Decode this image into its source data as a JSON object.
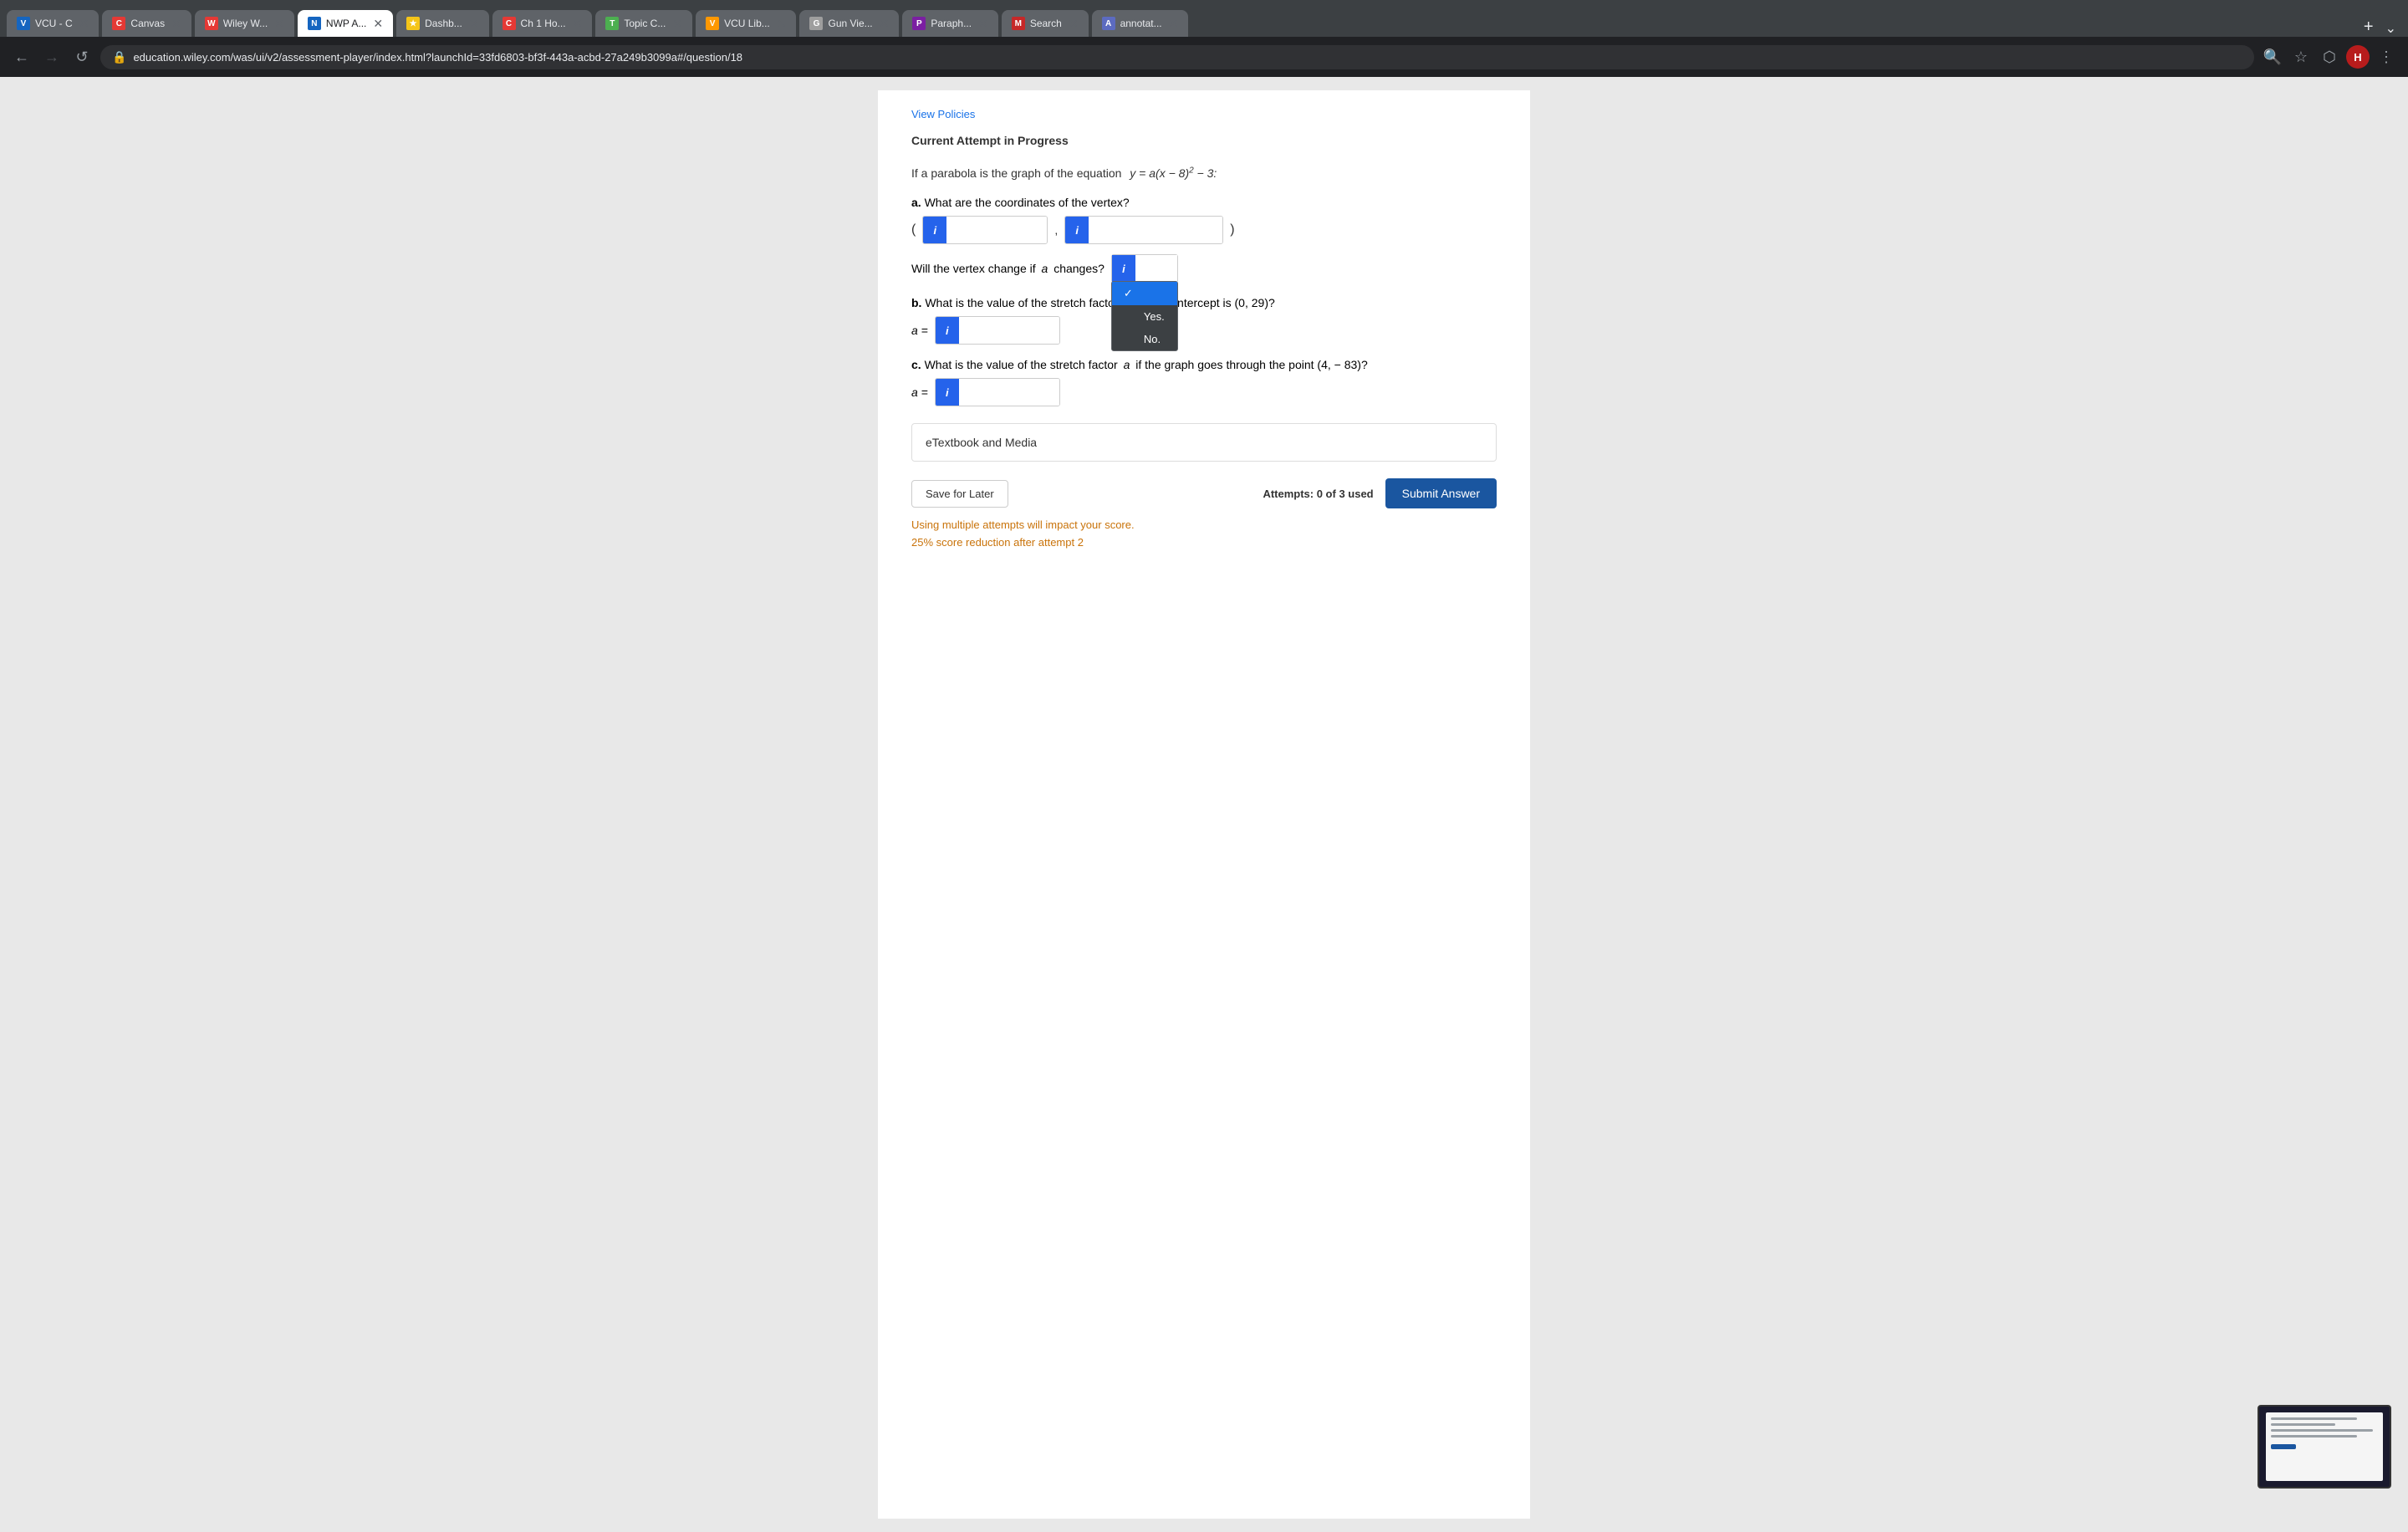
{
  "browser": {
    "url": "education.wiley.com/was/ui/v2/assessment-player/index.html?launchId=33fd6803-bf3f-443a-acbd-27a249b3099a#/question/18",
    "tabs": [
      {
        "id": "vcu1",
        "label": "VCU - C",
        "color": "#1565C0",
        "initials": "VCU",
        "active": false
      },
      {
        "id": "canvas",
        "label": "Canvas",
        "color": "#E53935",
        "initials": "C",
        "active": false
      },
      {
        "id": "wiley",
        "label": "Wiley W...",
        "color": "#E53935",
        "initials": "W",
        "active": false
      },
      {
        "id": "nwp",
        "label": "NWP A...",
        "color": "#1565C0",
        "initials": "NW",
        "active": true
      },
      {
        "id": "dashb",
        "label": "Dashb...",
        "color": "#f5c518",
        "initials": "★",
        "active": false
      },
      {
        "id": "ch1",
        "label": "Ch 1 Ho...",
        "color": "#E53935",
        "initials": "C",
        "active": false
      },
      {
        "id": "topic",
        "label": "Topic C...",
        "color": "#4CAF50",
        "initials": "T",
        "active": false
      },
      {
        "id": "vculib",
        "label": "VCU Lib...",
        "color": "#FF9800",
        "initials": "V",
        "active": false
      },
      {
        "id": "gunvie",
        "label": "Gun Vie...",
        "color": "#9E9E9E",
        "initials": "G",
        "active": false
      },
      {
        "id": "paraph",
        "label": "Paraph...",
        "color": "#7B1FA2",
        "initials": "P",
        "active": false
      },
      {
        "id": "search",
        "label": "Search",
        "color": "#C62828",
        "initials": "M",
        "active": false
      },
      {
        "id": "annot",
        "label": "annotat...",
        "color": "#5C6BC0",
        "initials": "A",
        "active": false
      }
    ],
    "nav": {
      "back": "←",
      "forward": "→",
      "refresh": "↺",
      "search_icon": "🔍",
      "star_icon": "☆",
      "puzzle_icon": "⬡",
      "profile_initial": "H"
    }
  },
  "page": {
    "view_policies_label": "View Policies",
    "current_attempt_label": "Current Attempt in Progress",
    "question_intro": "If a parabola is the graph of the equation",
    "equation": "y = a(x − 8)² − 3:",
    "part_a_label": "a.",
    "part_a_question": "What are the coordinates of the vertex?",
    "part_b_label": "b.",
    "part_b_question": "What is the value of the stretch factor",
    "part_b_suffix": "if the y-intercept is (0, 29)?",
    "part_b_var": "a",
    "part_c_label": "c.",
    "part_c_question": "What is the value of the stretch factor",
    "part_c_var": "a",
    "part_c_suffix": "if the graph goes through the point (4, − 83)?",
    "vertex_question_suffix": "Will the vertex change if",
    "vertex_var": "a",
    "vertex_question_end": "changes?",
    "dropdown_selected": "",
    "dropdown_options": [
      "Yes.",
      "No."
    ],
    "a_equals": "a =",
    "etextbook_label": "eTextbook and Media",
    "save_later_label": "Save for Later",
    "attempts_label": "Attempts: 0 of 3 used",
    "submit_label": "Submit Answer",
    "warning_line1": "Using multiple attempts will impact your score.",
    "warning_line2": "25% score reduction after attempt 2",
    "input_info_icon": "i"
  }
}
